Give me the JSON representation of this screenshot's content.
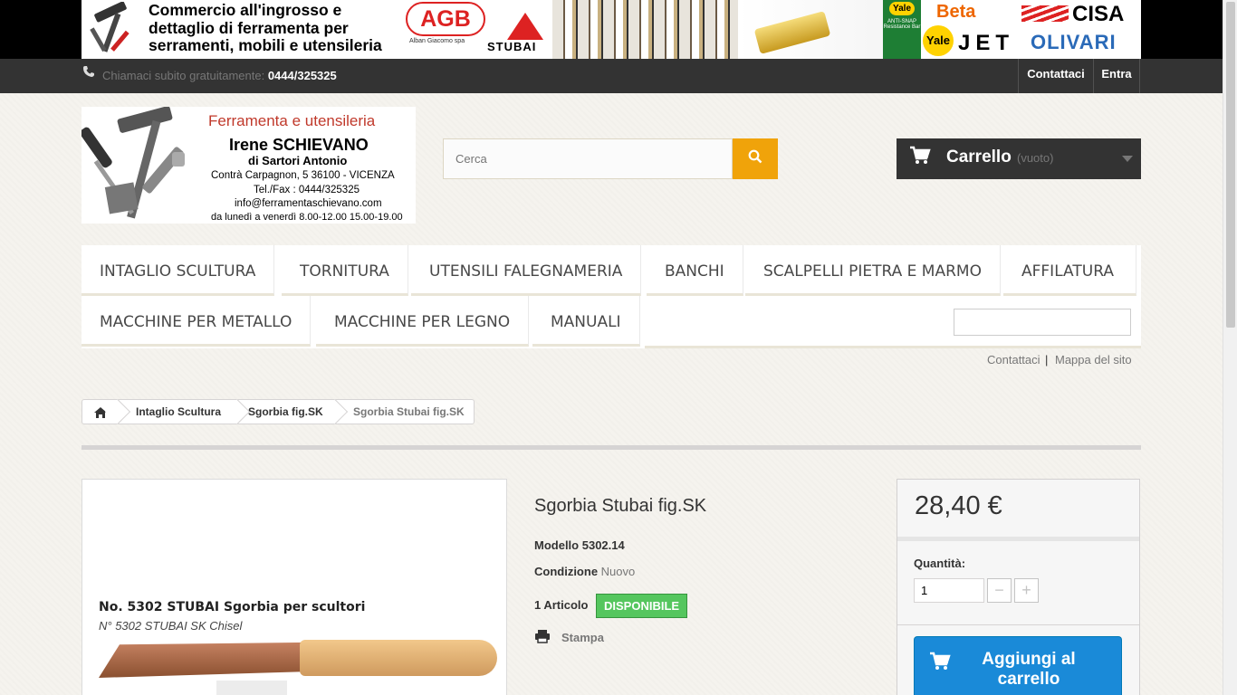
{
  "banner": {
    "line1": "Commercio all'ingrosso e",
    "line2": "dettaglio di ferramenta per",
    "line3": "serramenti, mobili e utensileria",
    "agb": "AGB",
    "agb_sub": "Alban Giacomo spa",
    "stubai": "STUBAI",
    "yale": "Yale",
    "anti_snap": "ANTI-SNAP Resistance Bar",
    "beta": "Beta",
    "cisa": "CISA",
    "jet": "JET",
    "olivari": "OLIVARI"
  },
  "topbar": {
    "call_text": "Chiamaci subito gratuitamente:",
    "phone": "0444/325325",
    "contact": "Contattaci",
    "login": "Entra"
  },
  "logo": {
    "title": "Ferramenta e utensileria",
    "name": "Irene SCHIEVANO",
    "sub": "di Sartori Antonio",
    "address": "Contrà Carpagnon, 5      36100 - VICENZA",
    "tel": "Tel./Fax : 0444/325325",
    "email": "info@ferramentaschievano.com",
    "hours": "da lunedì a venerdì 8.00-12.00 15.00-19.00"
  },
  "search": {
    "placeholder": "Cerca"
  },
  "cart": {
    "label": "Carrello",
    "status": "(vuoto)"
  },
  "menu": {
    "items": [
      "Intaglio Scultura",
      "Tornitura",
      "Utensili Falegnameria",
      "Banchi",
      "Scalpelli pietra e marmo",
      "Affilatura",
      "Macchine per metallo",
      "Macchine per legno",
      "Manuali"
    ]
  },
  "links": {
    "contact": "Contattaci",
    "separator": "|",
    "sitemap": "Mappa del sito"
  },
  "breadcrumb": [
    "Intaglio Scultura",
    "Sgorbia fig.SK",
    "Sgorbia Stubai fig.SK"
  ],
  "product": {
    "image_title": "No. 5302 STUBAI  Sgorbia per scultori",
    "image_subtitle": "N° 5302 STUBAI SK Chisel",
    "name": "Sgorbia Stubai fig.SK",
    "model_label": "Modello",
    "model": "5302.14",
    "condition_label": "Condizione",
    "condition": "Nuovo",
    "stock": "1 Articolo",
    "availability": "DISPONIBILE",
    "print": "Stampa",
    "price": "28,40 €",
    "quantity_label": "Quantità:",
    "quantity": "1",
    "add_to_cart": "Aggiungi al carrello"
  },
  "colors": {
    "accent": "#f0a30a",
    "cart_bg": "#333333",
    "available": "#55c65e",
    "add_btn": "#1a8ad8"
  }
}
